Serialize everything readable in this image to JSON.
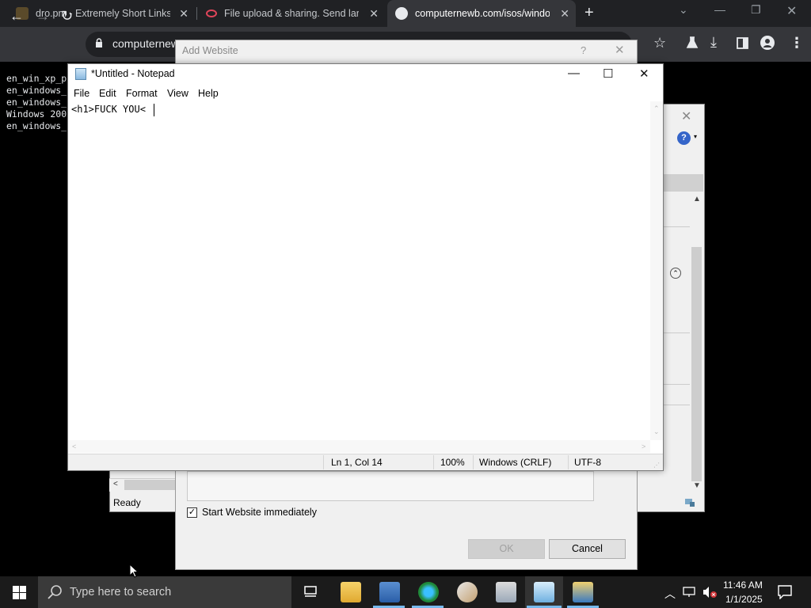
{
  "browser": {
    "tabs": [
      {
        "title": "dro.pm - Extremely Short Links",
        "close": "✕"
      },
      {
        "title": "File upload & sharing. Send larg",
        "close": "✕"
      },
      {
        "title": "computernewb.com/isos/windo",
        "close": "✕"
      }
    ],
    "new_tab": "+",
    "url": "computernew",
    "window_controls": {
      "chevron": "⌄",
      "minimize": "—",
      "restore": "❐",
      "close": "✕"
    },
    "nav": {
      "back": "←",
      "forward": "→",
      "reload": "↻"
    },
    "toolbar": {
      "star": "☆",
      "download": "⤓",
      "menu": "⋮"
    }
  },
  "page_listing": [
    "en_win_xp_p",
    "en_windows_",
    "en_windows_",
    "Windows 200",
    "en_windows_"
  ],
  "iis_manager": {
    "status": "Ready",
    "close": "✕",
    "help": "?"
  },
  "add_website": {
    "title": "Add Website",
    "help": "?",
    "close": "✕",
    "checkbox_label": "Start Website immediately",
    "checkbox_checked": true,
    "ok_label": "OK",
    "cancel_label": "Cancel"
  },
  "notepad": {
    "title": "*Untitled - Notepad",
    "menu": [
      "File",
      "Edit",
      "Format",
      "View",
      "Help"
    ],
    "content": "<h1>FUCK YOU<",
    "status": {
      "position": "Ln 1, Col 14",
      "zoom": "100%",
      "line_endings": "Windows (CRLF)",
      "encoding": "UTF-8"
    },
    "controls": {
      "minimize": "—",
      "maximize": "☐",
      "close": "✕"
    }
  },
  "taskbar": {
    "search_placeholder": "Type here to search",
    "time": "11:46 AM",
    "date": "1/1/2025"
  },
  "colors": {
    "chrome_dark": "#202124",
    "chrome_toolbar": "#35363a",
    "taskbar": "#1b1b1b",
    "accent": "#76b9ed"
  }
}
